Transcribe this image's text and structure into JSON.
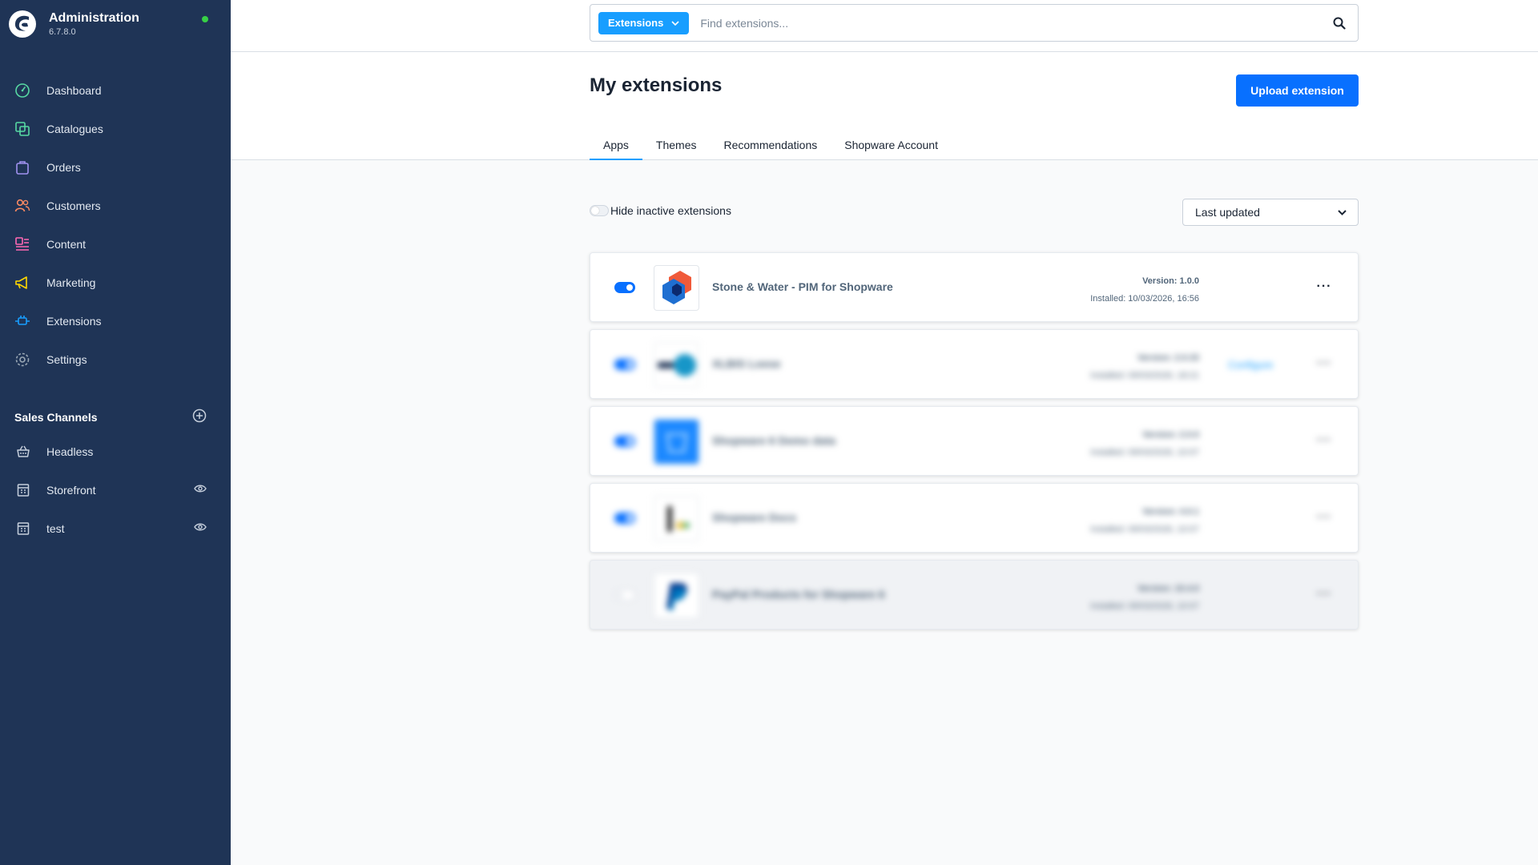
{
  "sidebar": {
    "title": "Administration",
    "version": "6.7.8.0",
    "nav": [
      {
        "label": "Dashboard",
        "icon": "dashboard-gauge-icon",
        "color": "#57d9a3"
      },
      {
        "label": "Catalogues",
        "icon": "catalogue-icon",
        "color": "#57d9a3"
      },
      {
        "label": "Orders",
        "icon": "orders-bag-icon",
        "color": "#a092f0"
      },
      {
        "label": "Customers",
        "icon": "customers-icon",
        "color": "#f88962"
      },
      {
        "label": "Content",
        "icon": "content-icon",
        "color": "#ff68b4"
      },
      {
        "label": "Marketing",
        "icon": "marketing-megaphone-icon",
        "color": "#ffd700"
      },
      {
        "label": "Extensions",
        "icon": "extensions-plug-icon",
        "color": "#189eff"
      },
      {
        "label": "Settings",
        "icon": "settings-gear-icon",
        "color": "#9aa8b5"
      }
    ],
    "sales_channels": {
      "title": "Sales Channels",
      "items": [
        {
          "label": "Headless",
          "icon": "basket-icon"
        },
        {
          "label": "Storefront",
          "icon": "storefront-icon"
        },
        {
          "label": "test",
          "icon": "storefront-icon"
        }
      ]
    }
  },
  "search": {
    "type_label": "Extensions",
    "placeholder": "Find extensions..."
  },
  "page": {
    "title": "My extensions",
    "upload_label": "Upload extension",
    "tabs": [
      "Apps",
      "Themes",
      "Recommendations",
      "Shopware Account"
    ],
    "active_tab": "Apps"
  },
  "filters": {
    "hide_inactive_label": "Hide inactive extensions",
    "sort_label": "Last updated"
  },
  "extensions": [
    {
      "name": "Stone & Water - PIM for Shopware",
      "version": "Version: 1.0.0",
      "installed": "Installed: 10/03/2026, 16:56",
      "active": true
    },
    {
      "name": "XLBIS Loese",
      "version": "Version: 2.0.33",
      "installed": "Installed: 09/03/2026, 18:21",
      "configure": "Configure",
      "active": true
    },
    {
      "name": "Shopware 6 Demo data",
      "version": "Version: 2.0.0",
      "installed": "Installed: 09/03/2026, 10:07",
      "active": true
    },
    {
      "name": "Shopware Docs",
      "version": "Version: 4.0.1",
      "installed": "Installed: 09/03/2026, 10:07",
      "active": true
    },
    {
      "name": "PayPal Products for Shopware 6",
      "version": "Version: 10.4.0",
      "installed": "Installed: 09/03/2026, 10:07",
      "active": false
    }
  ],
  "colors": {
    "sidebar_bg": "#1f3456",
    "accent": "#189eff",
    "primary_button": "#0870ff",
    "status_online": "#37d046"
  }
}
